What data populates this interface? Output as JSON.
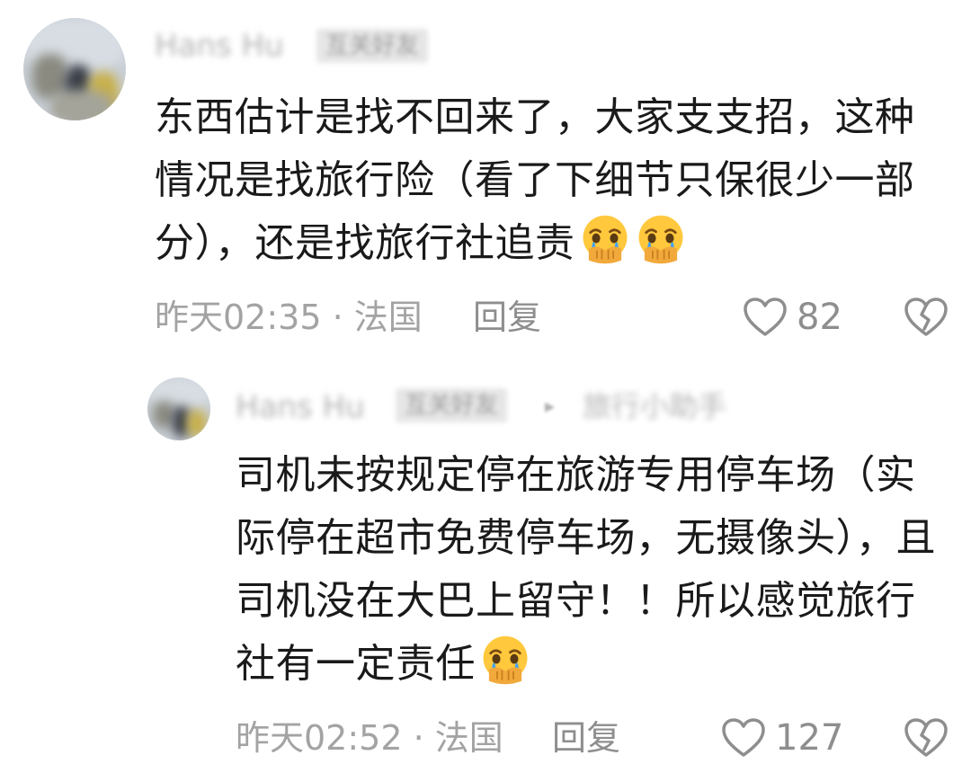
{
  "comments": [
    {
      "username": "Hans Hu",
      "tag": "互关好友",
      "text": "东西估计是找不回来了，大家支支招，这种情况是找旅行险（看了下细节只保很少一部分），还是找旅行社追责",
      "meta": "昨天02:35 · 法国",
      "reply_label": "回复",
      "likes": "82"
    },
    {
      "username": "Hans Hu",
      "tag": "互关好友",
      "reply_arrow": "▸",
      "reply_to": "旅行小助手",
      "text": "司机未按规定停在旅游专用停车场（实际停在超市免费停车场，无摄像头），且司机没在大巴上留守！！所以感觉旅行社有一定责任",
      "meta": "昨天02:52 · 法国",
      "reply_label": "回复",
      "likes": "127"
    }
  ],
  "icons": {
    "emoji": "crying-hands-over-mouth-emoji",
    "like": "heart-outline-icon",
    "dislike": "broken-heart-icon"
  },
  "colors": {
    "text": "#1a1a1a",
    "meta": "#a3a3a3",
    "action": "#8e8e8e",
    "emoji_face": "#ffc83d",
    "emoji_tear": "#3ea1f5"
  }
}
